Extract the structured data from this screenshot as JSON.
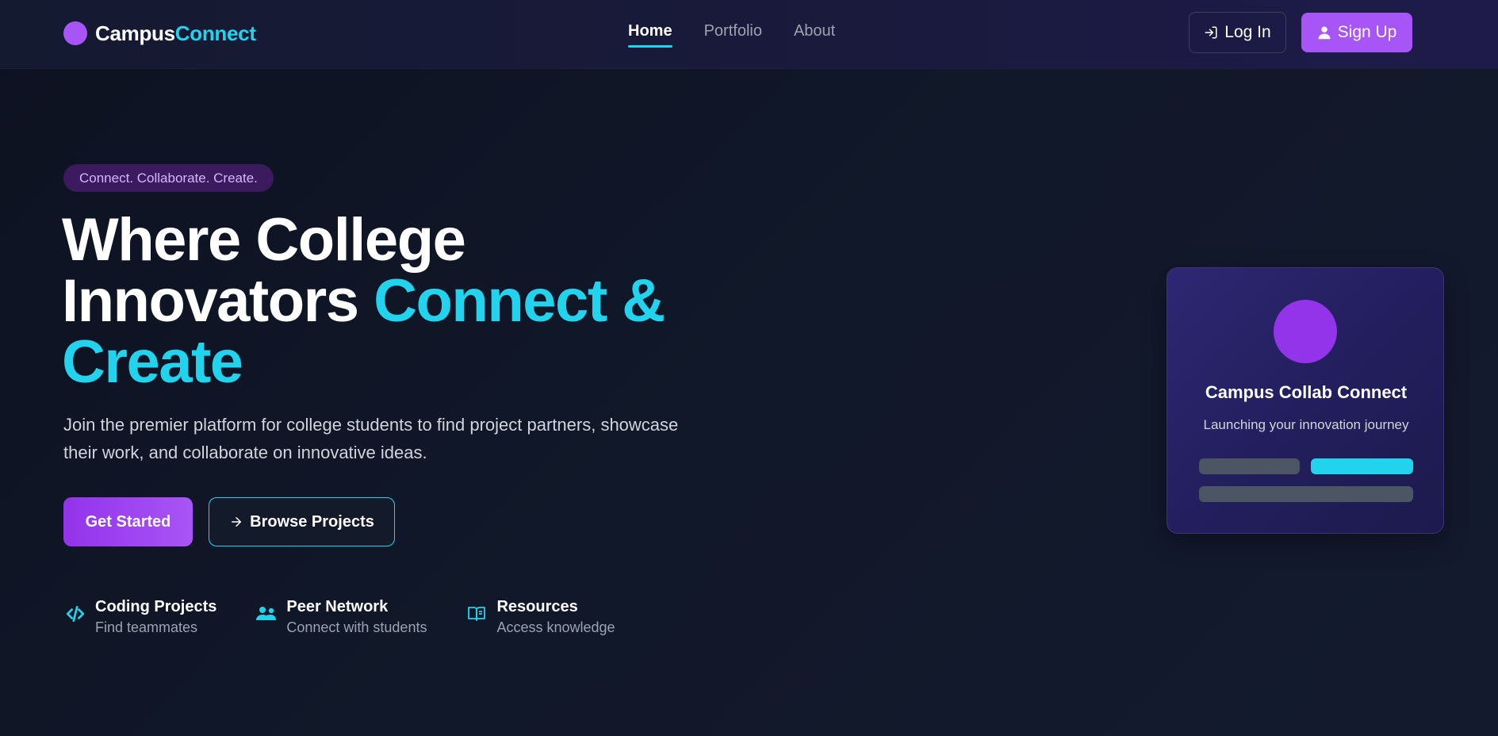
{
  "brand": {
    "name_part1": "Campus",
    "name_part2": "Connect",
    "dot_color": "#a855f7"
  },
  "nav": {
    "items": [
      {
        "label": "Home",
        "active": true
      },
      {
        "label": "Portfolio",
        "active": false
      },
      {
        "label": "About",
        "active": false
      }
    ]
  },
  "auth": {
    "login_label": "Log In",
    "login_icon": "login-arrow-icon",
    "signup_label": "Sign Up",
    "signup_icon": "user-icon"
  },
  "hero": {
    "tagline": "Connect. Collaborate. Create.",
    "headline_line1": "Where College",
    "headline_line2_white": "Innovators",
    "headline_line2_cyan": "Connect &",
    "headline_line3_cyan": "Create",
    "subtitle": "Join the premier platform for college students to find project partners, showcase their work, and collaborate on innovative ideas.",
    "primary_cta": "Get Started",
    "secondary_cta": "Browse Projects",
    "secondary_cta_icon": "arrow-right-icon"
  },
  "features": [
    {
      "icon": "code-icon",
      "title": "Coding Projects",
      "subtitle": "Find teammates"
    },
    {
      "icon": "users-icon",
      "title": "Peer Network",
      "subtitle": "Connect with students"
    },
    {
      "icon": "book-open-icon",
      "title": "Resources",
      "subtitle": "Access knowledge"
    }
  ],
  "card": {
    "title": "Campus Collab Connect",
    "subtitle": "Launching your innovation journey"
  },
  "colors": {
    "accent_purple": "#a855f7",
    "accent_cyan": "#22d3ee",
    "background": "#0f1424"
  }
}
